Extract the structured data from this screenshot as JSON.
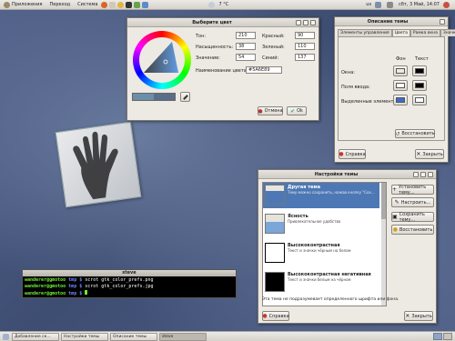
{
  "colors": {
    "accent": "#4d78b5",
    "window_bg": "#ede9e3",
    "selected_swatch": "#6c8ea8"
  },
  "top_panel": {
    "menus": [
      "Приложения",
      "Переход",
      "Система"
    ],
    "weather": "7 °C",
    "user": "us",
    "clock": "сбт, 3 Май, 14:07"
  },
  "color_dialog": {
    "title": "Выберите цвет",
    "hue_label": "Тон:",
    "hue_value": "210",
    "saturation_label": "Насыщенность:",
    "saturation_value": "38",
    "value_label": "Значение:",
    "value_value": "54",
    "red_label": "Красный:",
    "red_value": "90",
    "green_label": "Зеленый:",
    "green_value": "110",
    "blue_label": "Синий:",
    "blue_value": "137",
    "color_name_label": "Наименование цвета:",
    "color_name_value": "#5A6E89",
    "cancel_label": "Отмена",
    "ok_label": "Ok"
  },
  "theme_details": {
    "title": "Описание темы",
    "tabs": [
      "Элементы управления",
      "Цвета",
      "Рамка окна",
      "Значки"
    ],
    "active_tab": "Цвета",
    "col_bg": "Фон",
    "col_text": "Текст",
    "rows": [
      {
        "label": "Окна:",
        "bg": "#ede9e3",
        "text": "#000000"
      },
      {
        "label": "Поля ввода:",
        "bg": "#ffffff",
        "text": "#000000"
      },
      {
        "label": "Выделенные элементы:",
        "bg": "#3d6cc7",
        "text": "#ffffff"
      }
    ],
    "reset_label": "Восстановить",
    "help_label": "Справка",
    "close_label": "Закрыть"
  },
  "theme_prefs": {
    "title": "Настройки темы",
    "themes": [
      {
        "name": "Другая тема",
        "desc": "Тему можно сохранить, нажав кнопку \"Сох..."
      },
      {
        "name": "Ясность",
        "desc": "Привлекательное удобство"
      },
      {
        "name": "Высококонтрастная",
        "desc": "Текст и значки чёрным на белом"
      },
      {
        "name": "Высококонтрастная негативная",
        "desc": "Текст и значки белым на чёрном"
      }
    ],
    "install_label": "Установить тему...",
    "customize_label": "Настроить...",
    "save_label": "Сохранить тему...",
    "revert_label": "Восстановить",
    "footer_text": "Эта тема не подразумевает определенного шрифта или фона.",
    "help_label": "Справка",
    "close_label": "Закрыть"
  },
  "terminal": {
    "title": "steve",
    "lines": [
      {
        "user": "wanderer@gmotoo",
        "dir": "tmp $",
        "cmd": "scrot gtk_color_prefs.png"
      },
      {
        "user": "wanderer@gmotoo",
        "dir": "tmp $",
        "cmd": "scrot gtk_color_prefs.jpg"
      },
      {
        "user": "wanderer@gmotoo",
        "dir": "tmp $",
        "cmd": ""
      }
    ]
  },
  "taskbar": {
    "items": [
      "Добавление ск...",
      "Настройки темы",
      "Описание темы",
      "steve"
    ],
    "active": 3
  }
}
